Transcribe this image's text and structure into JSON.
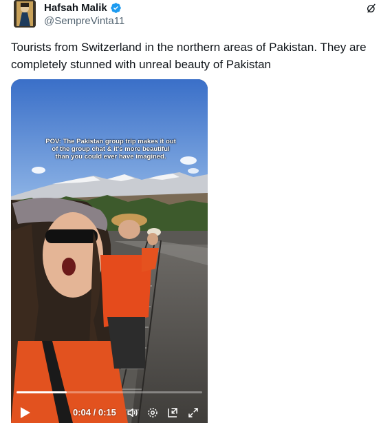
{
  "author": {
    "name": "Hafsah Malik",
    "handle": "@SempreVinta11",
    "verified": true
  },
  "tweet": {
    "text": "Tourists from Switzerland in the northern areas of Pakistan. They are completely stunned with unreal beauty of Pakistan"
  },
  "video": {
    "caption": "POV: The Pakistan group trip makes it out of the group chat & it's more beautiful than you could ever have imagined.",
    "time_display": "0:04 / 0:15",
    "progress_fraction": 0.27
  },
  "icons": {
    "verified": "verified-badge-icon",
    "grok": "grok-icon",
    "play": "play-icon",
    "volume": "volume-icon",
    "settings": "settings-icon",
    "pip": "picture-in-picture-icon",
    "fullscreen": "fullscreen-icon"
  },
  "colors": {
    "verified": "#1d9bf0",
    "handle": "#536471",
    "text": "#0f1419"
  }
}
